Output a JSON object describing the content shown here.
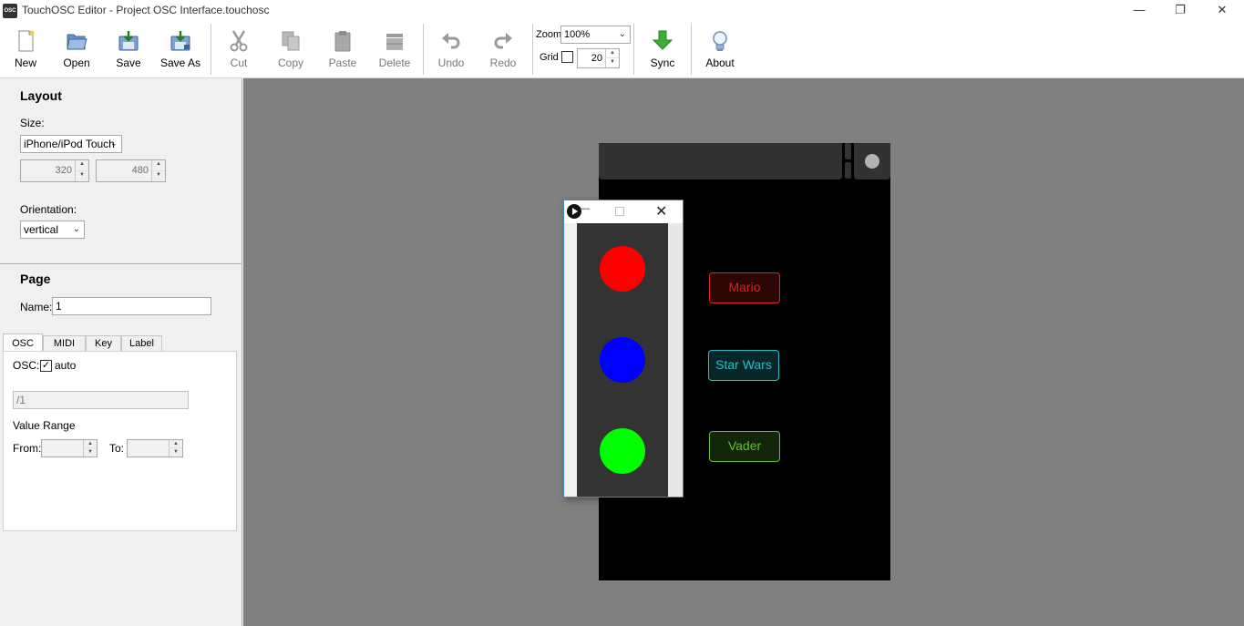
{
  "window": {
    "app_icon_text": "OSC",
    "title": "TouchOSC Editor - Project OSC Interface.touchosc",
    "minimize": "—",
    "restore": "❐",
    "close": "✕"
  },
  "toolbar": {
    "new": "New",
    "open": "Open",
    "save": "Save",
    "save_as": "Save As",
    "cut": "Cut",
    "copy": "Copy",
    "paste": "Paste",
    "delete": "Delete",
    "undo": "Undo",
    "redo": "Redo",
    "zoom_label": "Zoom",
    "zoom_value": "100%",
    "grid_label": "Grid",
    "grid_value": "20",
    "sync": "Sync",
    "about": "About"
  },
  "layout": {
    "title": "Layout",
    "size_label": "Size:",
    "size_value": "iPhone/iPod Touch",
    "width": "320",
    "height": "480",
    "orientation_label": "Orientation:",
    "orientation_value": "vertical"
  },
  "page": {
    "title": "Page",
    "name_label": "Name:",
    "name_value": "1",
    "tabs": [
      {
        "label": "OSC"
      },
      {
        "label": "MIDI"
      },
      {
        "label": "Key"
      },
      {
        "label": "Label"
      }
    ],
    "osc_label": "OSC:",
    "auto_label": "auto",
    "auto_check": "✓",
    "osc_address": "/1",
    "value_range_label": "Value Range",
    "from_label": "From:",
    "to_label": "To:"
  },
  "device": {
    "buttons": [
      {
        "label": "Mario",
        "color": "#e02020"
      },
      {
        "label": "Star Wars",
        "color": "#20c0c8"
      },
      {
        "label": "Vader",
        "color": "#60c030"
      }
    ]
  },
  "float_window": {
    "min": "—",
    "close": "✕",
    "dots": [
      {
        "color": "#ff0000"
      },
      {
        "color": "#0000ff"
      },
      {
        "color": "#00ff00"
      }
    ]
  }
}
